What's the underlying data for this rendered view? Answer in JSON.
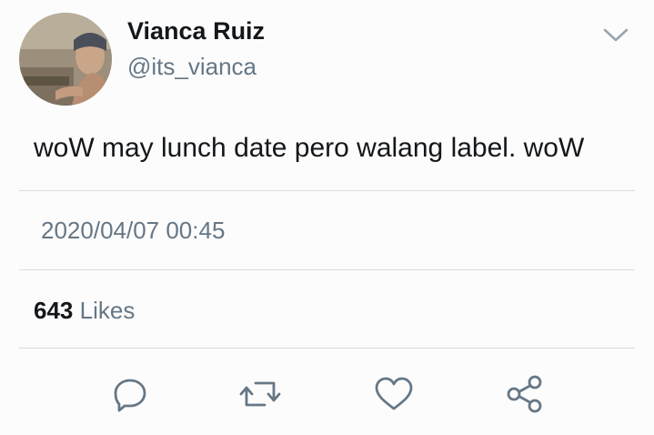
{
  "author": {
    "display_name": "Vianca Ruiz",
    "handle": "@its_vianca",
    "avatar_icon": "profile-photo"
  },
  "tweet": {
    "text": "woW may lunch date pero walang label. woW",
    "timestamp": "2020/04/07 00:45"
  },
  "stats": {
    "likes_count": "643",
    "likes_label": "Likes"
  },
  "actions": [
    {
      "icon": "reply-icon"
    },
    {
      "icon": "retweet-icon"
    },
    {
      "icon": "like-icon"
    },
    {
      "icon": "share-icon"
    }
  ],
  "colors": {
    "text_primary": "#14171a",
    "text_secondary": "#657786",
    "icon": "#657786",
    "divider": "#dcdcdc",
    "background": "#fcfcfc"
  }
}
